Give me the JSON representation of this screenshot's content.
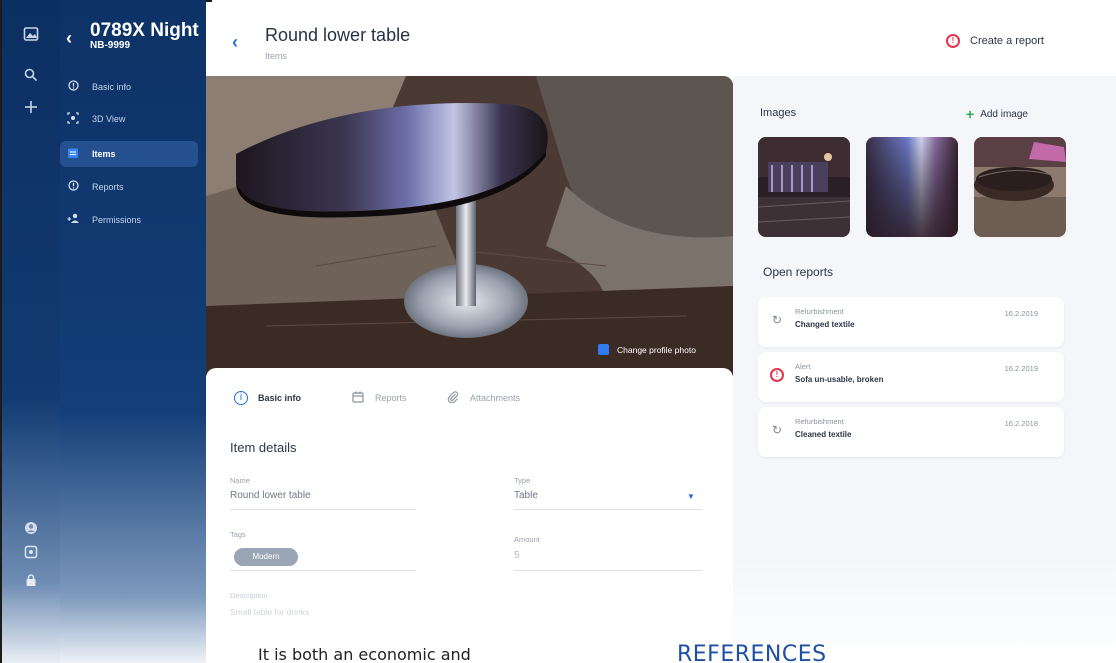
{
  "rail": {
    "icons": [
      "photo-icon",
      "search-icon",
      "plus-icon",
      "user-icon",
      "settings-icon",
      "lock-icon"
    ]
  },
  "nav": {
    "title": "0789X Night",
    "subtitle": "NB-9999",
    "items": [
      {
        "label": "Basic info",
        "icon": "info-icon"
      },
      {
        "label": "3D View",
        "icon": "3d-view-icon"
      },
      {
        "label": "Items",
        "icon": "items-icon",
        "active": true
      },
      {
        "label": "Reports",
        "icon": "report-icon"
      },
      {
        "label": "Permissions",
        "icon": "permissions-icon"
      }
    ]
  },
  "header": {
    "title": "Round lower table",
    "subtitle": "Items",
    "report_button": "Create a report"
  },
  "photo": {
    "change_label": "Change profile photo"
  },
  "tabs": [
    {
      "label": "Basic info",
      "active": true
    },
    {
      "label": "Reports"
    },
    {
      "label": "Attachments"
    }
  ],
  "details": {
    "title": "Item details",
    "name_label": "Name",
    "name_value": "Round lower table",
    "type_label": "Type",
    "type_value": "Table",
    "tags_label": "Tags",
    "tag": "Modern",
    "amount_label": "Amount",
    "amount_value": "5",
    "description_label": "Description",
    "description_value": "Small table for drinks"
  },
  "images": {
    "title": "Images",
    "add_label": "Add image"
  },
  "open_reports": {
    "title": "Open reports",
    "items": [
      {
        "type": "Refurbishment",
        "desc": "Changed textile",
        "date": "16.2.2019",
        "icon": "refresh-icon"
      },
      {
        "type": "Alert",
        "desc": "Sofa un-usable, broken",
        "date": "16.2.2019",
        "icon": "alert-icon"
      },
      {
        "type": "Refurbishment",
        "desc": "Cleaned textile",
        "date": "16.2.2018",
        "icon": "refresh-icon"
      }
    ]
  },
  "document": {
    "text": "It is both an economic and",
    "heading": "REFERENCES"
  },
  "colors": {
    "nav_bg": "#0d3266",
    "accent_blue": "#1f6fe0",
    "alert_red": "#e8344a",
    "add_green": "#2bb04a"
  }
}
